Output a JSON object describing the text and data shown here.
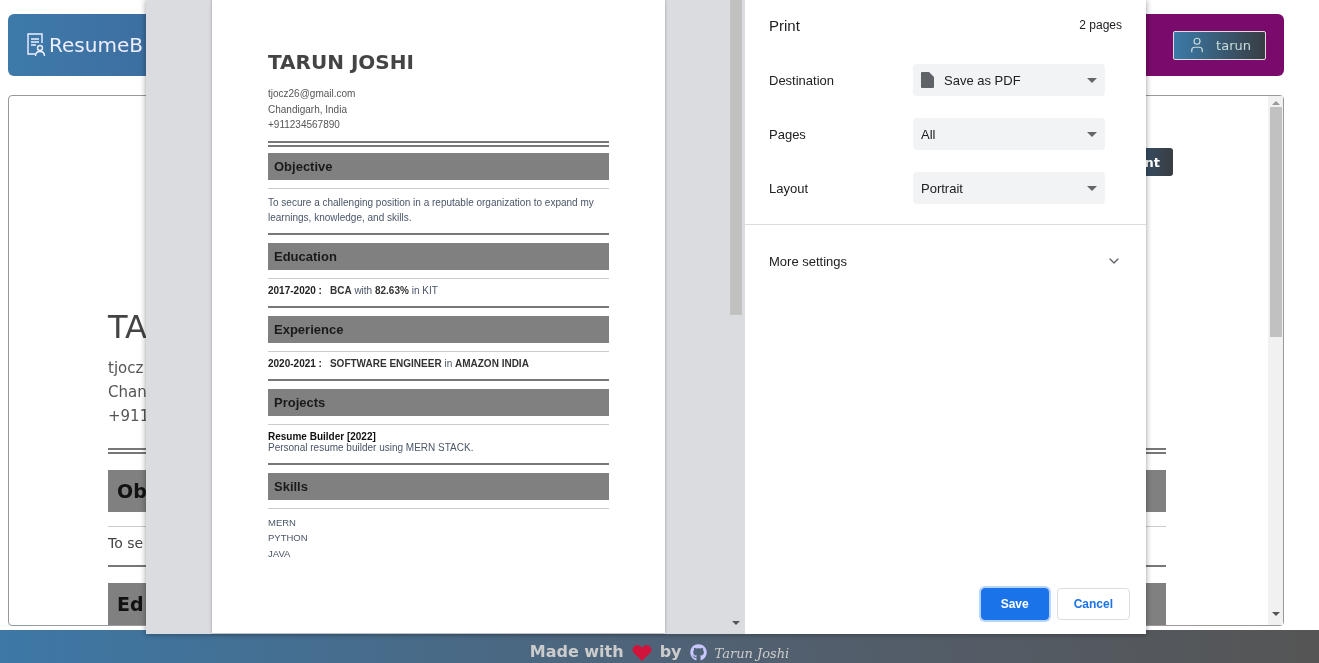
{
  "navbar": {
    "brand": "ResumeB",
    "user_button": "tarun"
  },
  "resume_view": {
    "download_button": "nt",
    "name": "TA",
    "contact": [
      "tjocz",
      "Chan",
      "+911"
    ],
    "sections": [
      {
        "heading": "Ob",
        "body": "To se"
      },
      {
        "heading": "Ed"
      }
    ]
  },
  "footer": {
    "made_with": "Made with",
    "by": "by",
    "author": "Tarun Joshi"
  },
  "print_dialog": {
    "preview": {
      "name": "TARUN JOSHI",
      "contact": [
        "tjocz26@gmail.com",
        "Chandigarh, India",
        "+911234567890"
      ],
      "sections": [
        {
          "heading": "Objective",
          "kind": "paragraph",
          "text": "To secure a challenging position in a reputable organization to expand my learnings, knowledge, and skills."
        },
        {
          "heading": "Education",
          "kind": "entries",
          "entries": [
            {
              "years": "2017-2020 :",
              "text": "**BCA** with **82.63%** in KIT"
            }
          ]
        },
        {
          "heading": "Experience",
          "kind": "entries",
          "entries": [
            {
              "years": "2020-2021 :",
              "text": "**SOFTWARE ENGINEER** in **AMAZON INDIA**"
            }
          ]
        },
        {
          "heading": "Projects",
          "kind": "projects",
          "projects": [
            {
              "title": "Resume Builder [2022]",
              "description": "Personal resume builder using MERN STACK."
            }
          ]
        },
        {
          "heading": "Skills",
          "kind": "list",
          "items": [
            "MERN",
            "PYTHON",
            "JAVA"
          ]
        }
      ]
    },
    "title": "Print",
    "page_count": "2 pages",
    "settings": [
      {
        "label": "Destination",
        "value": "Save as PDF",
        "kind": "destination"
      },
      {
        "label": "Pages",
        "value": "All",
        "kind": "select"
      },
      {
        "label": "Layout",
        "value": "Portrait",
        "kind": "select"
      }
    ],
    "more_settings": {
      "label": "More settings",
      "expanded": false
    },
    "buttons": [
      {
        "label": "Save",
        "kind": "primary"
      },
      {
        "label": "Cancel",
        "kind": "secondary"
      }
    ]
  }
}
